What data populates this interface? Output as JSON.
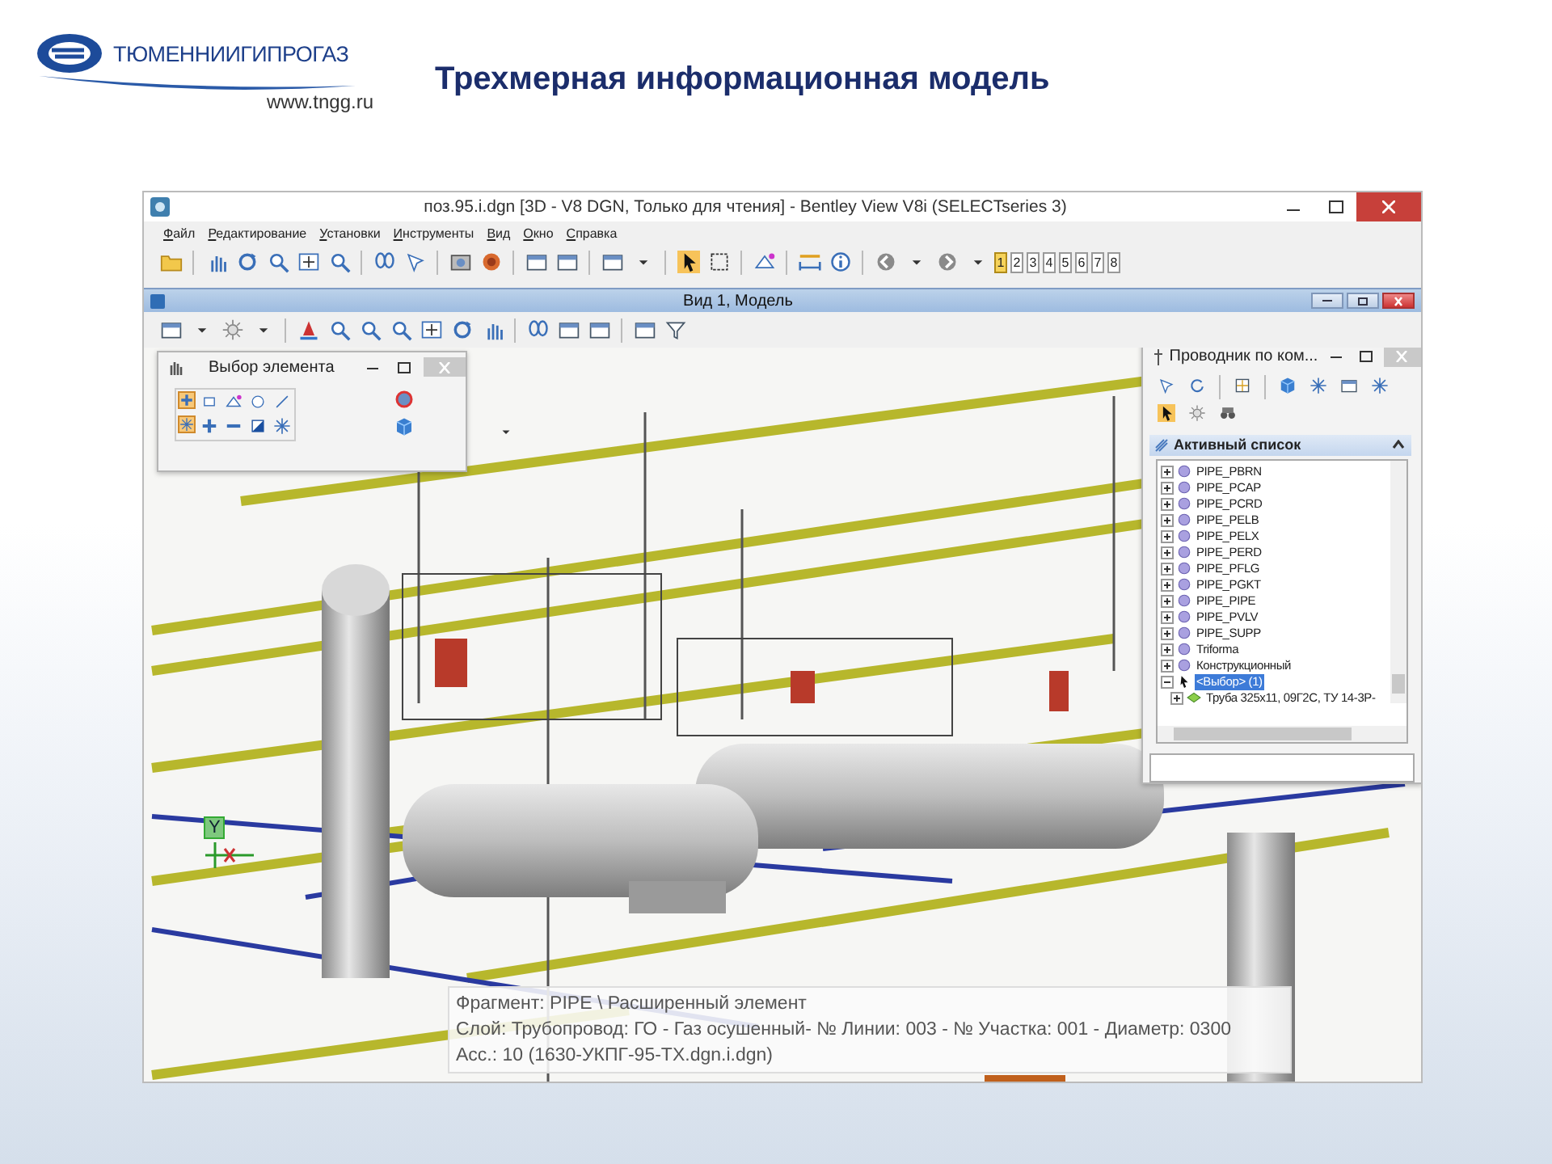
{
  "slide": {
    "logo": {
      "name": "ТЮМЕННИИГИПРОГАЗ",
      "url": "www.tngg.ru"
    },
    "title": "Трехмерная информационная модель"
  },
  "app_window": {
    "title": "поз.95.i.dgn [3D - V8 DGN, Только для чтения] - Bentley View V8i (SELECTseries 3)",
    "menu": [
      "Файл",
      "Редактирование",
      "Установки",
      "Инструменты",
      "Вид",
      "Окно",
      "Справка"
    ],
    "view_buttons": [
      {
        "label": "1",
        "selected": true
      },
      {
        "label": "2",
        "selected": false
      },
      {
        "label": "3",
        "selected": false
      },
      {
        "label": "4",
        "selected": false
      },
      {
        "label": "5",
        "selected": false
      },
      {
        "label": "6",
        "selected": false
      },
      {
        "label": "7",
        "selected": false
      },
      {
        "label": "8",
        "selected": false
      }
    ]
  },
  "view_window": {
    "title": "Вид 1, Модель",
    "axis_label": "Y"
  },
  "select_panel": {
    "title": "Выбор элемента"
  },
  "explorer": {
    "title": "Проводник по ком...",
    "section": "Активный список",
    "items": [
      {
        "kind": "model",
        "label": "PIPE_PBRN",
        "expanded": false,
        "selected": false
      },
      {
        "kind": "model",
        "label": "PIPE_PCAP",
        "expanded": false,
        "selected": false
      },
      {
        "kind": "model",
        "label": "PIPE_PCRD",
        "expanded": false,
        "selected": false
      },
      {
        "kind": "model",
        "label": "PIPE_PELB",
        "expanded": false,
        "selected": false
      },
      {
        "kind": "model",
        "label": "PIPE_PELX",
        "expanded": false,
        "selected": false
      },
      {
        "kind": "model",
        "label": "PIPE_PERD",
        "expanded": false,
        "selected": false
      },
      {
        "kind": "model",
        "label": "PIPE_PFLG",
        "expanded": false,
        "selected": false
      },
      {
        "kind": "model",
        "label": "PIPE_PGKT",
        "expanded": false,
        "selected": false
      },
      {
        "kind": "model",
        "label": "PIPE_PIPE",
        "expanded": false,
        "selected": false
      },
      {
        "kind": "model",
        "label": "PIPE_PVLV",
        "expanded": false,
        "selected": false
      },
      {
        "kind": "model",
        "label": "PIPE_SUPP",
        "expanded": false,
        "selected": false
      },
      {
        "kind": "model",
        "label": "Triforma",
        "expanded": false,
        "selected": false
      },
      {
        "kind": "model",
        "label": "Конструкционный",
        "expanded": false,
        "selected": false
      },
      {
        "kind": "selection",
        "label": "<Выбор> (1)",
        "expanded": true,
        "selected": true,
        "children": [
          {
            "kind": "element",
            "label": "Труба 325x11, 09Г2С, ТУ 14-3Р-",
            "expanded": false,
            "selected": false
          }
        ]
      }
    ]
  },
  "tooltip": {
    "lines": [
      "Фрагмент: PIPE \\ Расширенный элемент",
      "Слой: Трубопровод:  ГО - Газ осушенный- № Линии: 003 - № Участка: 001 - Диаметр: 0300",
      "Асс.: 10 (1630-УКПГ-95-ТХ.dgn.i.dgn)"
    ]
  }
}
